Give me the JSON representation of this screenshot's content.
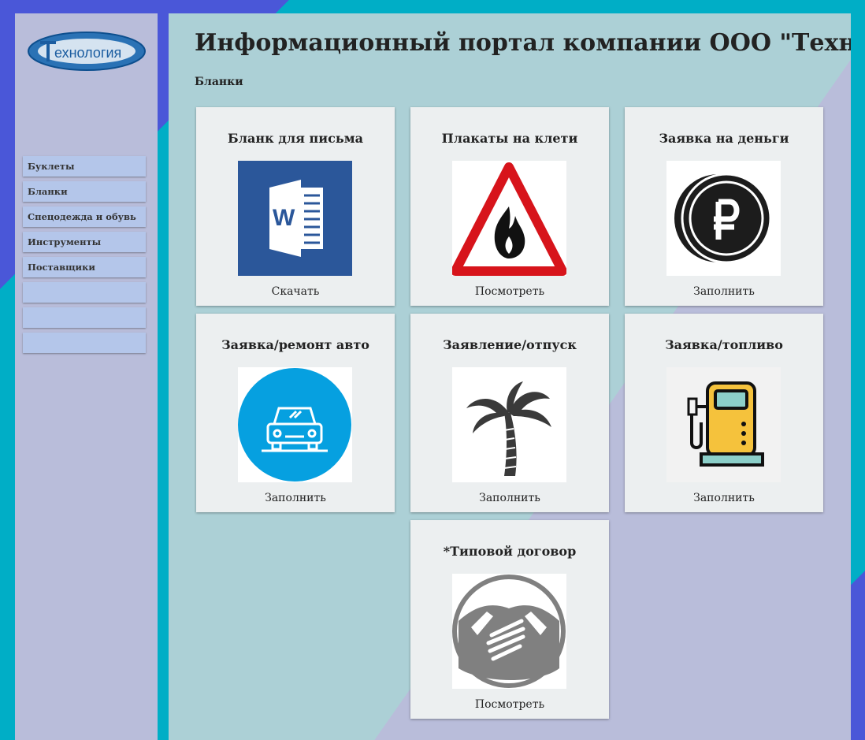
{
  "logo": {
    "text": "ехнология"
  },
  "sidebar": {
    "items": [
      {
        "label": "Буклеты"
      },
      {
        "label": "Бланки"
      },
      {
        "label": "Спецодежда и обувь"
      },
      {
        "label": "Инструменты"
      },
      {
        "label": "Поставщики"
      },
      {
        "label": ""
      },
      {
        "label": ""
      },
      {
        "label": ""
      }
    ]
  },
  "header": {
    "title": "Информационный портал компании ООО \"Технология\"",
    "section": "Бланки"
  },
  "cards": [
    {
      "title": "Бланк для письма",
      "action": "Скачать",
      "icon": "word-document-icon"
    },
    {
      "title": "Плакаты на клети",
      "action": "Посмотреть",
      "icon": "fire-warning-icon"
    },
    {
      "title": "Заявка на деньги",
      "action": "Заполнить",
      "icon": "ruble-coin-icon"
    },
    {
      "title": "Заявка/ремонт авто",
      "action": "Заполнить",
      "icon": "car-icon"
    },
    {
      "title": "Заявление/отпуск",
      "action": "Заполнить",
      "icon": "palm-tree-icon"
    },
    {
      "title": "Заявка/топливо",
      "action": "Заполнить",
      "icon": "fuel-pump-icon"
    },
    {
      "title": "*Типовой договор",
      "action": "Посмотреть",
      "icon": "handshake-icon"
    }
  ],
  "colors": {
    "sidebar": "#b9bdda",
    "nav_item": "#b4c6ea",
    "card": "#eceff0",
    "accent_blue": "#4a57d8",
    "accent_teal": "#00aec6"
  }
}
